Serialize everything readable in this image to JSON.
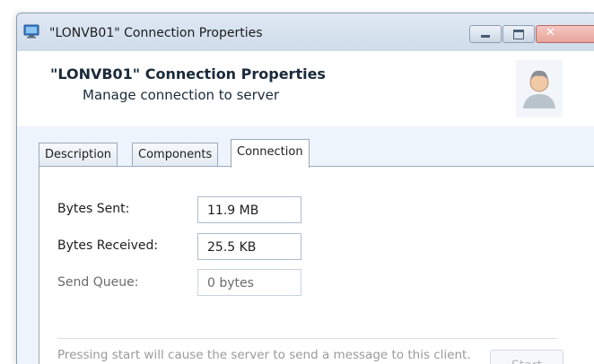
{
  "window": {
    "title": "\"LONVB01\" Connection Properties"
  },
  "header": {
    "title": "\"LONVB01\" Connection Properties",
    "subtitle": "Manage connection to server",
    "avatar_icon": "user-avatar-icon"
  },
  "tabs": [
    {
      "label": "Description",
      "selected": false
    },
    {
      "label": "Components",
      "selected": false
    },
    {
      "label": "Connection",
      "selected": true
    }
  ],
  "connection": {
    "bytes_sent_label": "Bytes Sent:",
    "bytes_sent_value": "11.9 MB",
    "bytes_received_label": "Bytes Received:",
    "bytes_received_value": "25.5 KB",
    "send_queue_label": "Send Queue:",
    "send_queue_value": "0 bytes",
    "info_text": "Pressing start will cause the server to send a message to this client.  The client will then reply to the message.",
    "start_label": "Start"
  },
  "colors": {
    "title_bar": "#d7e3f0",
    "close_button": "#e7a49b",
    "panel_background": "#ffffff"
  }
}
